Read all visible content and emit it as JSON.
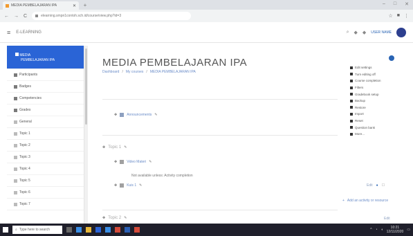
{
  "browser": {
    "tab_title": "MEDIA PEMBELAJARAN IPA",
    "new_tab": "+",
    "url": "elearning.smpn1contoh.sch.id/course/view.php?id=3",
    "controls": [
      "–",
      "□",
      "✕"
    ],
    "nav_back": "←",
    "nav_forward": "→",
    "nav_reload": "C"
  },
  "moodle_nav": {
    "menu_glyph": "≡",
    "site_name": "E-LEARNING",
    "user_name": "USER NAME"
  },
  "course": {
    "title": "MEDIA PEMBELAJARAN IPA",
    "breadcrumb": [
      "Dashboard",
      "My courses",
      "MEDIA PEMBELAJARAN IPA"
    ]
  },
  "sidebar": {
    "items": [
      {
        "label": "MEDIA",
        "sub": "PEMBELAJARAN IPA"
      },
      {
        "label": "Participants"
      },
      {
        "label": "Badges"
      },
      {
        "label": "Competencies"
      },
      {
        "label": "Grades"
      },
      {
        "label": "General"
      },
      {
        "label": "Topic 1"
      },
      {
        "label": "Topic 2"
      },
      {
        "label": "Topic 3"
      },
      {
        "label": "Topic 4"
      },
      {
        "label": "Topic 5"
      },
      {
        "label": "Topic 6"
      },
      {
        "label": "Topic 7"
      }
    ]
  },
  "settings_menu": {
    "items": [
      "Edit settings",
      "Turn editing off",
      "Course completion",
      "Filters",
      "Gradebook setup",
      "Backup",
      "Restore",
      "Import",
      "Reset",
      "Question bank",
      "More..."
    ]
  },
  "sections": {
    "announcements": "Announcements",
    "topic1_title": "Topic 1",
    "topic1_activity1": "Video Materi",
    "topic1_restrict": "Not available unless: Activity completion",
    "topic1_activity2": "Kuis 1",
    "edit_label": "Edit",
    "add_activity": "Add an activity or resource",
    "topic2_title": "Topic 2",
    "edit_label2": "Edit"
  },
  "taskbar": {
    "search_placeholder": "Type here to search",
    "time": "10:21",
    "date": "12/11/2020"
  }
}
